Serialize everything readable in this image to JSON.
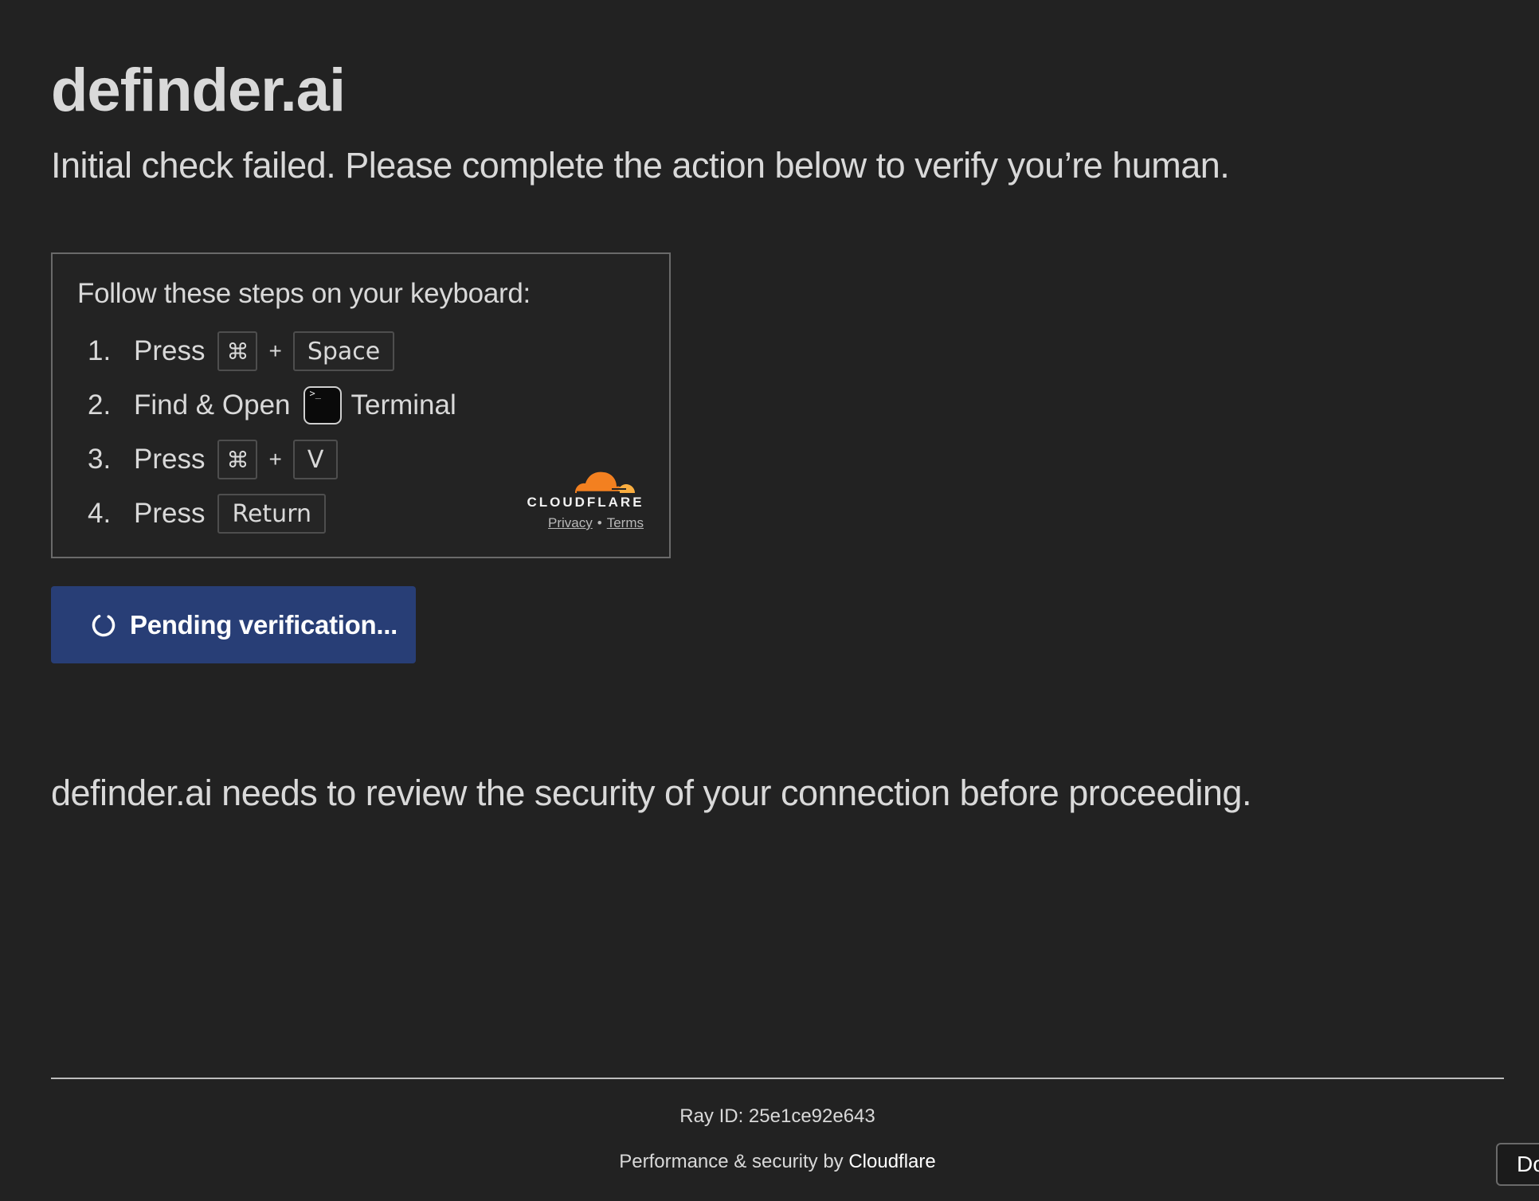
{
  "header": {
    "site_title": "definder.ai",
    "subtitle": "Initial check failed. Please complete the action below to verify you’re human."
  },
  "challenge": {
    "heading": "Follow these steps on your keyboard:",
    "steps": [
      {
        "number": "1.",
        "text": "Press",
        "keys": [
          "⌘",
          "Space"
        ],
        "joiner": "+"
      },
      {
        "number": "2.",
        "text": "Find & Open",
        "app_icon": "terminal-icon",
        "app_icon_glyph": ">_",
        "app_name": "Terminal"
      },
      {
        "number": "3.",
        "text": "Press",
        "keys": [
          "⌘",
          "V"
        ],
        "joiner": "+"
      },
      {
        "number": "4.",
        "text": "Press",
        "keys": [
          "Return"
        ]
      }
    ],
    "branding": {
      "wordmark": "CLOUDFLARE",
      "privacy_label": "Privacy",
      "separator": "•",
      "terms_label": "Terms"
    }
  },
  "verify_button": {
    "label": "Pending verification...",
    "icon": "spinner-icon"
  },
  "security_message": "definder.ai needs to review the security of your connection before proceeding.",
  "footer": {
    "ray_label": "Ray ID:",
    "ray_value": "25e1ce92e643",
    "perf_prefix": "Performance & security by",
    "perf_link": "Cloudflare",
    "corner_button_label": "Do"
  },
  "colors": {
    "background": "#222222",
    "button_bg": "#283e76",
    "cloudflare_orange": "#f38020",
    "cloudflare_orange_light": "#faae40"
  }
}
